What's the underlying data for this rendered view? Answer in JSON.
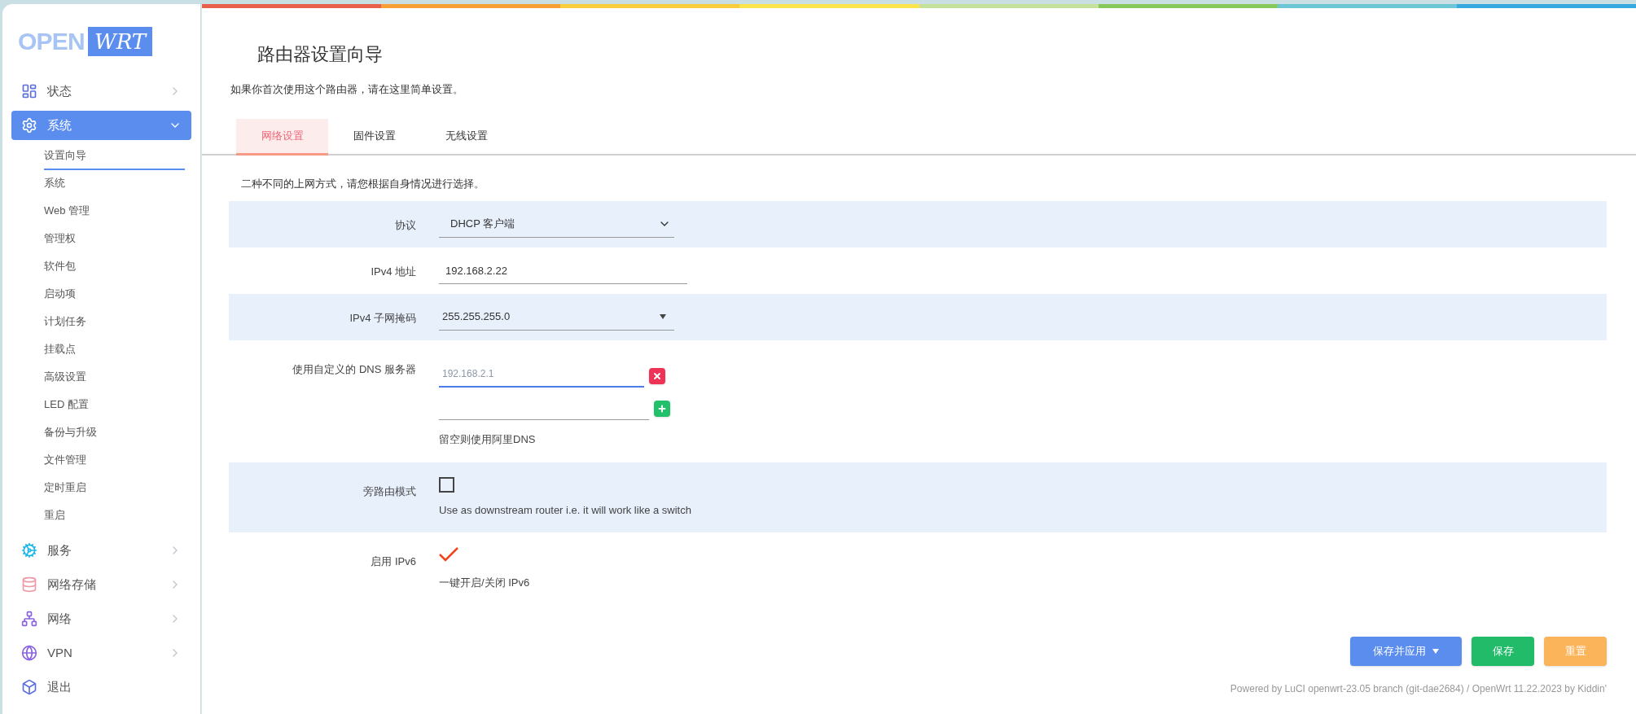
{
  "logo": {
    "left": "OPEN",
    "right": "WRT"
  },
  "sidebar": {
    "items": [
      {
        "label": "状态",
        "expanded": false,
        "selected": false
      },
      {
        "label": "系统",
        "expanded": true,
        "selected": true,
        "children": [
          {
            "label": "设置向导",
            "selected": true
          },
          {
            "label": "系统",
            "selected": false
          },
          {
            "label": "Web 管理",
            "selected": false
          },
          {
            "label": "管理权",
            "selected": false
          },
          {
            "label": "软件包",
            "selected": false
          },
          {
            "label": "启动项",
            "selected": false
          },
          {
            "label": "计划任务",
            "selected": false
          },
          {
            "label": "挂载点",
            "selected": false
          },
          {
            "label": "高级设置",
            "selected": false
          },
          {
            "label": "LED 配置",
            "selected": false
          },
          {
            "label": "备份与升级",
            "selected": false
          },
          {
            "label": "文件管理",
            "selected": false
          },
          {
            "label": "定时重启",
            "selected": false
          },
          {
            "label": "重启",
            "selected": false
          }
        ]
      },
      {
        "label": "服务",
        "expanded": false,
        "selected": false
      },
      {
        "label": "网络存储",
        "expanded": false,
        "selected": false
      },
      {
        "label": "网络",
        "expanded": false,
        "selected": false
      },
      {
        "label": "VPN",
        "expanded": false,
        "selected": false
      },
      {
        "label": "退出",
        "selected": false
      }
    ]
  },
  "page": {
    "title": "路由器设置向导",
    "subtitle": "如果你首次使用这个路由器，请在这里简单设置。"
  },
  "tabs": [
    {
      "label": "网络设置",
      "selected": true
    },
    {
      "label": "固件设置",
      "selected": false
    },
    {
      "label": "无线设置",
      "selected": false
    }
  ],
  "section_note": "二种不同的上网方式，请您根据自身情况进行选择。",
  "fields": [
    {
      "kind": "select",
      "label": "协议",
      "value": "DHCP 客户端"
    },
    {
      "kind": "text",
      "label": "IPv4 地址",
      "value": "192.168.2.22"
    },
    {
      "kind": "combo",
      "label": "IPv4 子网掩码",
      "value": "255.255.255.0"
    },
    {
      "kind": "dynlist",
      "label": "使用自定义的 DNS 服务器",
      "entries": [
        {
          "placeholder": "192.168.2.1",
          "kind": "remove",
          "focused": true
        },
        {
          "kind": "add",
          "focused": false
        }
      ],
      "description": "留空则使用阿里DNS"
    },
    {
      "kind": "checkbox",
      "label": "旁路由模式",
      "checked": false,
      "description": "Use as downstream router i.e. it will work like a switch"
    },
    {
      "kind": "tick",
      "label": "启用 IPv6",
      "checked": true,
      "description": "一键开启/关闭 IPv6"
    }
  ],
  "buttons": [
    {
      "kind": "apply",
      "label": "保存并应用"
    },
    {
      "kind": "save",
      "label": "保存"
    },
    {
      "kind": "reset",
      "label": "重置"
    }
  ],
  "footer": "Powered by LuCI openwrt-23.05 branch (git-dae2684) / OpenWrt 11.22.2023 by Kiddin'"
}
